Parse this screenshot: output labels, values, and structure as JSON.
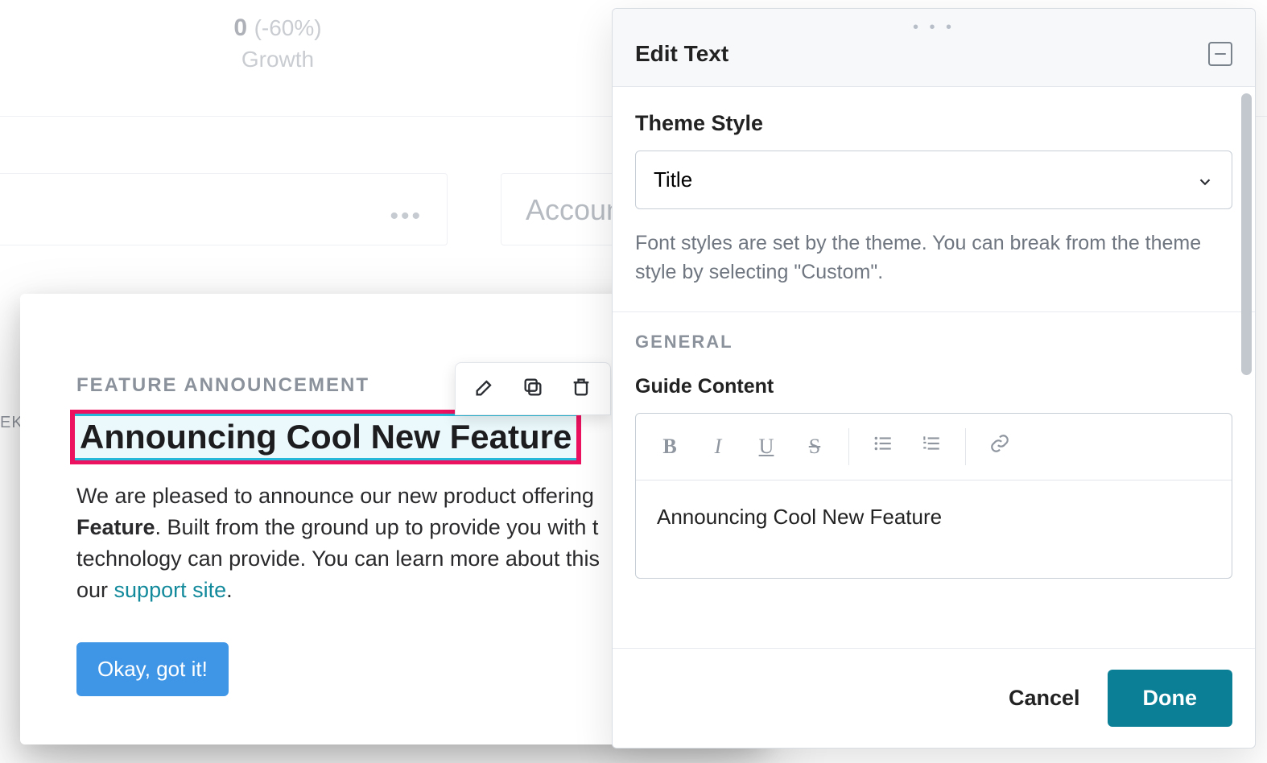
{
  "background": {
    "metric_value": "0",
    "metric_pct": "(-60%)",
    "metric_label": "Growth",
    "right_card_text": "Accoun",
    "side_label": "EK"
  },
  "guide": {
    "eyebrow": "FEATURE ANNOUNCEMENT",
    "title": "Announcing Cool New Feature",
    "body_line1_prefix": "We are pleased to announce our new product offering",
    "body_bold": "Feature",
    "body_after_bold": ". Built from the ground up to provide you with t",
    "body_line3": "technology can provide. You can learn more about this",
    "body_line4_prefix": "our ",
    "body_link": "support site",
    "body_line4_suffix": ".",
    "cta": "Okay, got it!",
    "actions": {
      "edit": "edit-icon",
      "copy": "copy-icon",
      "delete": "trash-icon"
    }
  },
  "panel": {
    "title": "Edit Text",
    "theme_label": "Theme Style",
    "theme_value": "Title",
    "theme_helper": "Font styles are set by the theme. You can break from the theme style by selecting \"Custom\".",
    "section_general": "GENERAL",
    "guide_content_label": "Guide Content",
    "editor_value": "Announcing Cool New Feature",
    "toolbar": {
      "bold": "B",
      "italic": "I",
      "underline": "U",
      "strike": "S"
    },
    "footer": {
      "cancel": "Cancel",
      "done": "Done"
    }
  }
}
